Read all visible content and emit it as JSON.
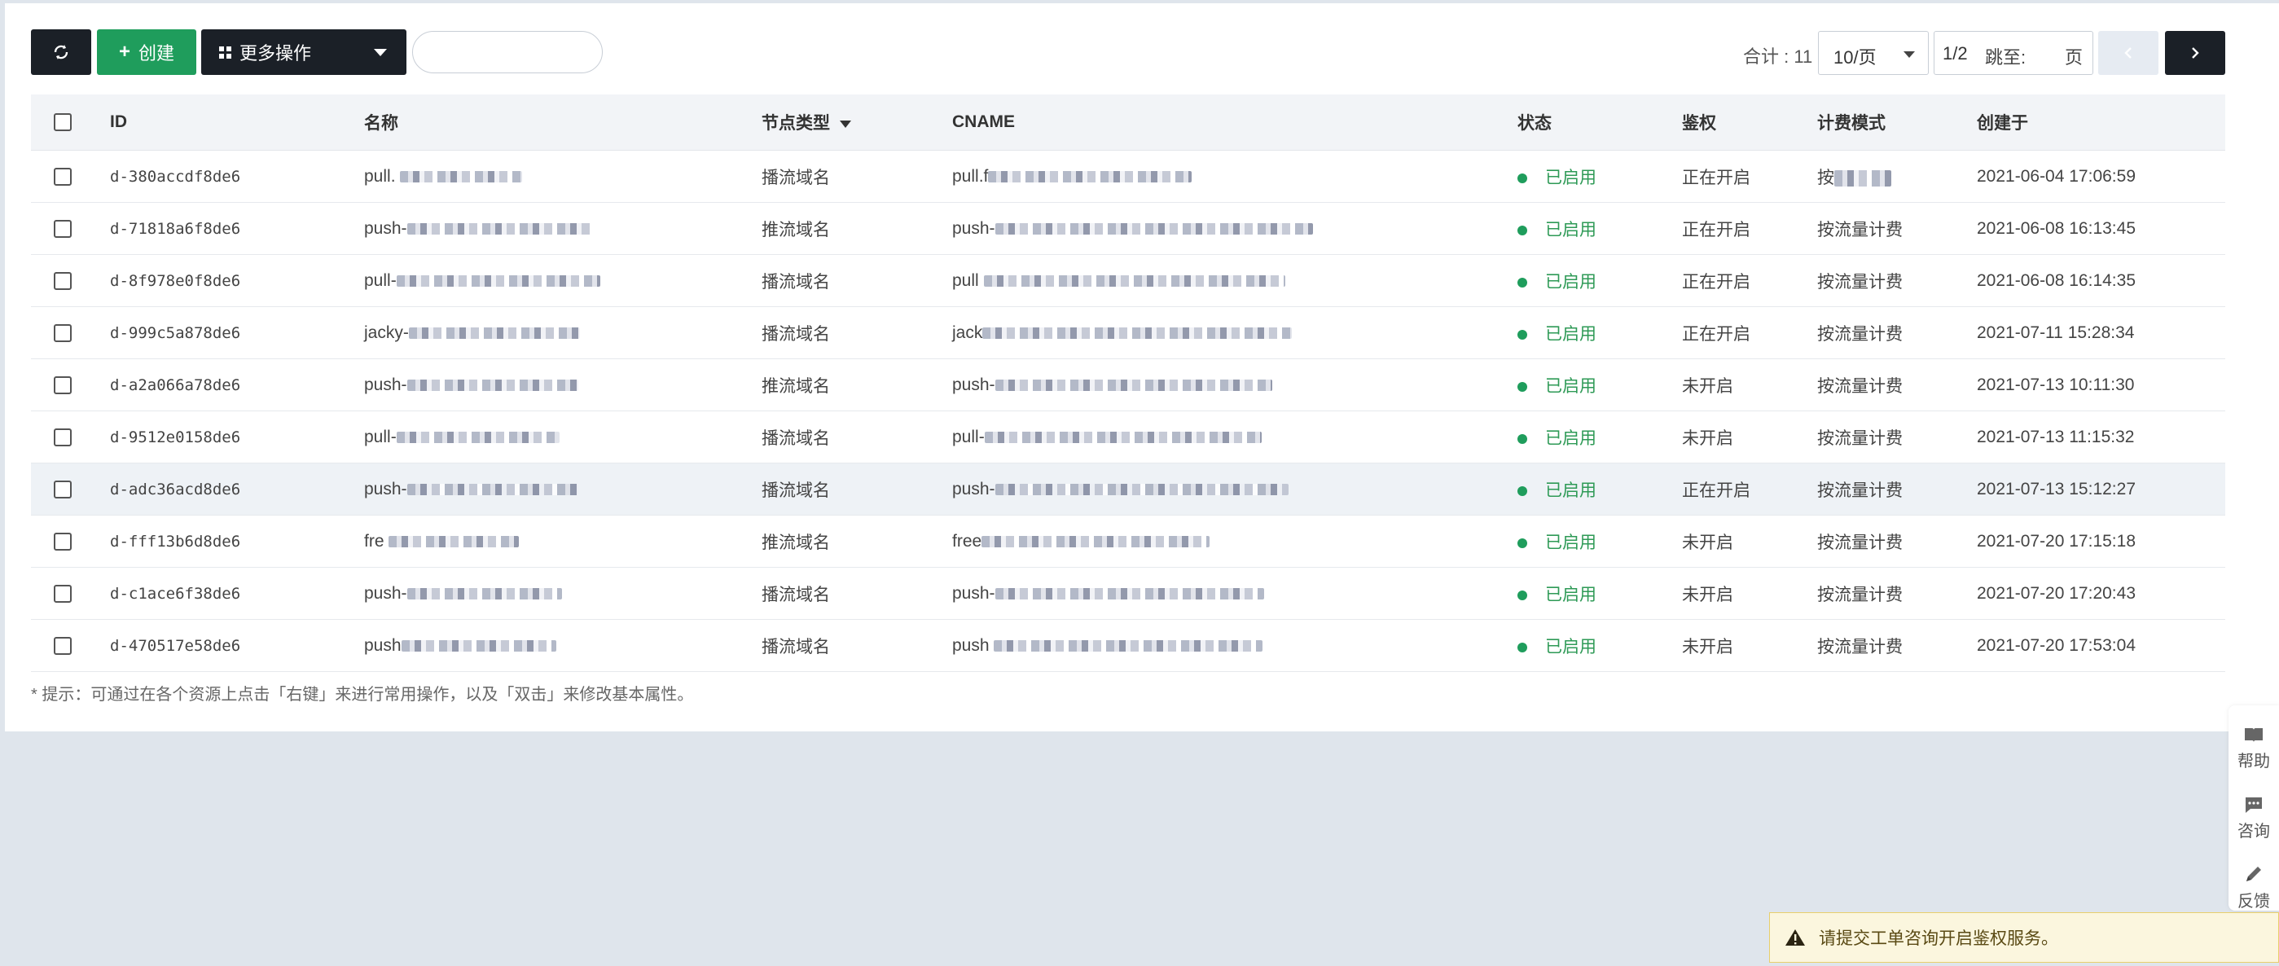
{
  "toolbar": {
    "create_label": "创建",
    "more_label": "更多操作",
    "search_placeholder": ""
  },
  "pager": {
    "total": "合计 : 11",
    "page_size": "10/页",
    "page": "1/2",
    "jump_label": "跳至:",
    "page_suffix": "页"
  },
  "table": {
    "headers": {
      "id": "ID",
      "name": "名称",
      "type": "节点类型",
      "cname": "CNAME",
      "state": "状态",
      "auth": "鉴权",
      "billing": "计费模式",
      "created": "创建于"
    },
    "rows": [
      {
        "id": "d-380accdf8de6",
        "name": "pull.",
        "type": "播流域名",
        "cname": "pull.f",
        "state": "已启用",
        "auth": "正在开启",
        "billing": "按",
        "created": "2021-06-04 17:06:59"
      },
      {
        "id": "d-71818a6f8de6",
        "name": "push-",
        "type": "推流域名",
        "cname": "push-",
        "state": "已启用",
        "auth": "正在开启",
        "billing": "按流量计费",
        "created": "2021-06-08 16:13:45"
      },
      {
        "id": "d-8f978e0f8de6",
        "name": "pull-",
        "type": "播流域名",
        "cname": "pull",
        "state": "已启用",
        "auth": "正在开启",
        "billing": "按流量计费",
        "created": "2021-06-08 16:14:35"
      },
      {
        "id": "d-999c5a878de6",
        "name": "jacky-",
        "type": "播流域名",
        "cname": "jack",
        "state": "已启用",
        "auth": "正在开启",
        "billing": "按流量计费",
        "created": "2021-07-11 15:28:34"
      },
      {
        "id": "d-a2a066a78de6",
        "name": "push-",
        "type": "推流域名",
        "cname": "push-",
        "state": "已启用",
        "auth": "未开启",
        "billing": "按流量计费",
        "created": "2021-07-13 10:11:30"
      },
      {
        "id": "d-9512e0158de6",
        "name": "pull-",
        "type": "播流域名",
        "cname": "pull-",
        "state": "已启用",
        "auth": "未开启",
        "billing": "按流量计费",
        "created": "2021-07-13 11:15:32"
      },
      {
        "id": "d-adc36acd8de6",
        "name": "push-",
        "type": "播流域名",
        "cname": "push-",
        "state": "已启用",
        "auth": "正在开启",
        "billing": "按流量计费",
        "created": "2021-07-13 15:12:27"
      },
      {
        "id": "d-fff13b6d8de6",
        "name": "fre",
        "type": "推流域名",
        "cname": "free",
        "state": "已启用",
        "auth": "未开启",
        "billing": "按流量计费",
        "created": "2021-07-20 17:15:18"
      },
      {
        "id": "d-c1ace6f38de6",
        "name": "push-",
        "type": "播流域名",
        "cname": "push-",
        "state": "已启用",
        "auth": "未开启",
        "billing": "按流量计费",
        "created": "2021-07-20 17:20:43"
      },
      {
        "id": "d-470517e58de6",
        "name": "push",
        "type": "播流域名",
        "cname": "push",
        "state": "已启用",
        "auth": "未开启",
        "billing": "按流量计费",
        "created": "2021-07-20 17:53:04"
      }
    ]
  },
  "hint": "* 提示：可通过在各个资源上点击「右键」来进行常用操作，以及「双击」来修改基本属性。",
  "sidebar": {
    "help": "帮助",
    "consult": "咨询",
    "feedback": "反馈"
  },
  "toast": {
    "message": "请提交工单咨询开启鉴权服务。"
  },
  "colors": {
    "accent_green": "#1f9d5c",
    "dark_button": "#1b2027",
    "link_blue": "#3a6fc4"
  }
}
